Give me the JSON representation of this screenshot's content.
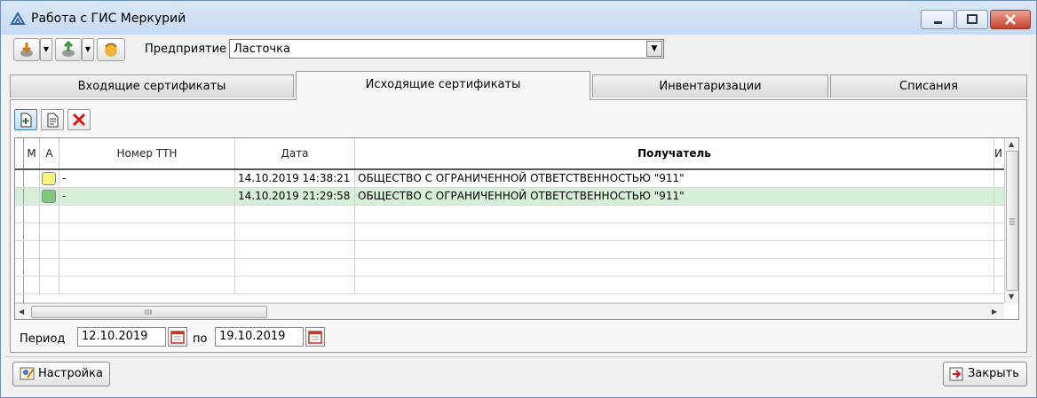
{
  "window": {
    "title": "Работа с ГИС Меркурий"
  },
  "toolbar": {
    "enterprise_label": "Предприятие",
    "enterprise_value": "Ласточка"
  },
  "tabs": [
    {
      "label": "Входящие сертификаты",
      "active": false
    },
    {
      "label": "Исходящие сертификаты",
      "active": true
    },
    {
      "label": "Инвентаризации",
      "active": false
    },
    {
      "label": "Списания",
      "active": false
    }
  ],
  "grid": {
    "columns": [
      "М",
      "А",
      "Номер ТТН",
      "Дата",
      "Получатель",
      "И"
    ],
    "rows": [
      {
        "status_color": "#f7f37a",
        "ttn": "-",
        "date": "14.10.2019 14:38:21",
        "recipient": "ОБЩЕСТВО С ОГРАНИЧЕННОЙ ОТВЕТСТВЕННОСТЬЮ \"911\""
      },
      {
        "status_color": "#7fc97f",
        "ttn": "-",
        "date": "14.10.2019 21:29:58",
        "recipient": "ОБЩЕСТВО С ОГРАНИЧЕННОЙ ОТВЕТСТВЕННОСТЬЮ \"911\""
      }
    ]
  },
  "period": {
    "label": "Период",
    "from": "12.10.2019",
    "to_label": "по",
    "to": "19.10.2019"
  },
  "footer": {
    "settings_label": "Настройка",
    "close_label": "Закрыть"
  }
}
